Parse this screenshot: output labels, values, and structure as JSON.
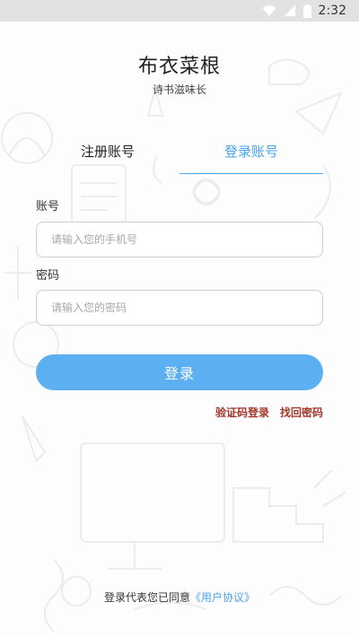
{
  "status_bar": {
    "time": "2:32",
    "icons": [
      "wifi-icon",
      "cellular-signal-icon",
      "battery-icon"
    ]
  },
  "app": {
    "title": "布衣菜根",
    "subtitle": "诗书滋味长"
  },
  "tabs": {
    "register": "注册账号",
    "login": "登录账号",
    "active": "login"
  },
  "form": {
    "account_label": "账号",
    "account_placeholder": "请输入您的手机号",
    "account_value": "",
    "password_label": "密码",
    "password_placeholder": "请输入您的密码",
    "password_value": ""
  },
  "actions": {
    "login_button": "登录",
    "sms_login": "验证码登录",
    "forgot_password": "找回密码"
  },
  "agreement": {
    "prefix": "登录代表您已同意",
    "link": "《用户协议》"
  },
  "colors": {
    "accent": "#4aa3ee",
    "button": "#5cb0f2",
    "link_red": "#a5372a",
    "status_bar": "#e2e2e2"
  }
}
